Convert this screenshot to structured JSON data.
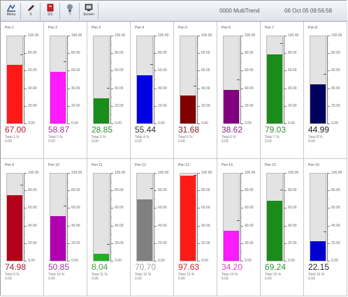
{
  "toolbar": {
    "buttons": [
      {
        "label": "Menu",
        "icon": "menu-icon"
      },
      {
        "label": "0",
        "icon": "pen-icon"
      },
      {
        "label": "0/1",
        "icon": "alarm-icon"
      },
      {
        "label": "?",
        "icon": "help-icon"
      },
      {
        "label": "Screen",
        "icon": "screen-icon"
      }
    ],
    "title": "0000 MultiTrend",
    "datetime": "06 Oct 05 09:56:58"
  },
  "scale_labels": [
    "100.00",
    "80.00",
    "60.00",
    "40.00",
    "20.00",
    "0.00"
  ],
  "pens": [
    {
      "name": "Pen 1",
      "value": "67.00",
      "level": 0.67,
      "color": "#ff1a1a",
      "value_color": "#c8102e",
      "total_label": "Total 1  %",
      "total_value": "0.00"
    },
    {
      "name": "Pen 2",
      "value": "58.87",
      "level": 0.589,
      "color": "#ff1aff",
      "value_color": "#b0309a",
      "total_label": "Total 2  %",
      "total_value": "0.00"
    },
    {
      "name": "Pen 3",
      "value": "28.85",
      "level": 0.289,
      "color": "#1a8c1a",
      "value_color": "#2f8f2f",
      "total_label": "Total 3  %",
      "total_value": "0.00"
    },
    {
      "name": "Pen 4",
      "value": "55.44",
      "level": 0.554,
      "color": "#0000e0",
      "value_color": "#333333",
      "total_label": "Total 4  %",
      "total_value": "0.00"
    },
    {
      "name": "Pen 5",
      "value": "31.68",
      "level": 0.317,
      "color": "#800000",
      "value_color": "#8a1a2a",
      "total_label": "Total 5  %",
      "total_value": "0.00"
    },
    {
      "name": "Pen 6",
      "value": "38.62",
      "level": 0.386,
      "color": "#800080",
      "value_color": "#8a2a8a",
      "total_label": "Total 6  %",
      "total_value": "0.00"
    },
    {
      "name": "Pen 7",
      "value": "79.03",
      "level": 0.79,
      "color": "#1a8c1a",
      "value_color": "#2f8f2f",
      "total_label": "Total 7  %",
      "total_value": "0.00"
    },
    {
      "name": "Pen 8",
      "value": "44.99",
      "level": 0.45,
      "color": "#00005e",
      "value_color": "#222222",
      "total_label": "Total 8  %",
      "total_value": "0.00"
    },
    {
      "name": "Pen 9",
      "value": "74.98",
      "level": 0.75,
      "color": "#b3001b",
      "value_color": "#a01a2a",
      "total_label": "Total 9  %",
      "total_value": "0.00"
    },
    {
      "name": "Pen 10",
      "value": "50.85",
      "level": 0.509,
      "color": "#b000b0",
      "value_color": "#a0309a",
      "total_label": "Total 10 %",
      "total_value": "0.00"
    },
    {
      "name": "Pen 11",
      "value": "8.04",
      "level": 0.08,
      "color": "#20b020",
      "value_color": "#40a040",
      "total_label": "Total 11 %",
      "total_value": "0.00"
    },
    {
      "name": "Pen 12",
      "value": "70.70",
      "level": 0.707,
      "color": "#808080",
      "value_color": "#a0a0a0",
      "total_label": "Total 12 %",
      "total_value": "0.00"
    },
    {
      "name": "Pen 13",
      "value": "97.63",
      "level": 0.976,
      "color": "#ff1a1a",
      "value_color": "#e01a1a",
      "total_label": "Total 13 %",
      "total_value": "0.00"
    },
    {
      "name": "Pen 14",
      "value": "34.20",
      "level": 0.342,
      "color": "#ff1aff",
      "value_color": "#e040d0",
      "total_label": "Total 14 %",
      "total_value": "0.00"
    },
    {
      "name": "Pen 15",
      "value": "69.24",
      "level": 0.692,
      "color": "#1a8c1a",
      "value_color": "#2f8f2f",
      "total_label": "Total 15 %",
      "total_value": "0.00"
    },
    {
      "name": "Pen 16",
      "value": "22.15",
      "level": 0.222,
      "color": "#0000d0",
      "value_color": "#222222",
      "total_label": "Total 16 %",
      "total_value": "0.00"
    }
  ]
}
